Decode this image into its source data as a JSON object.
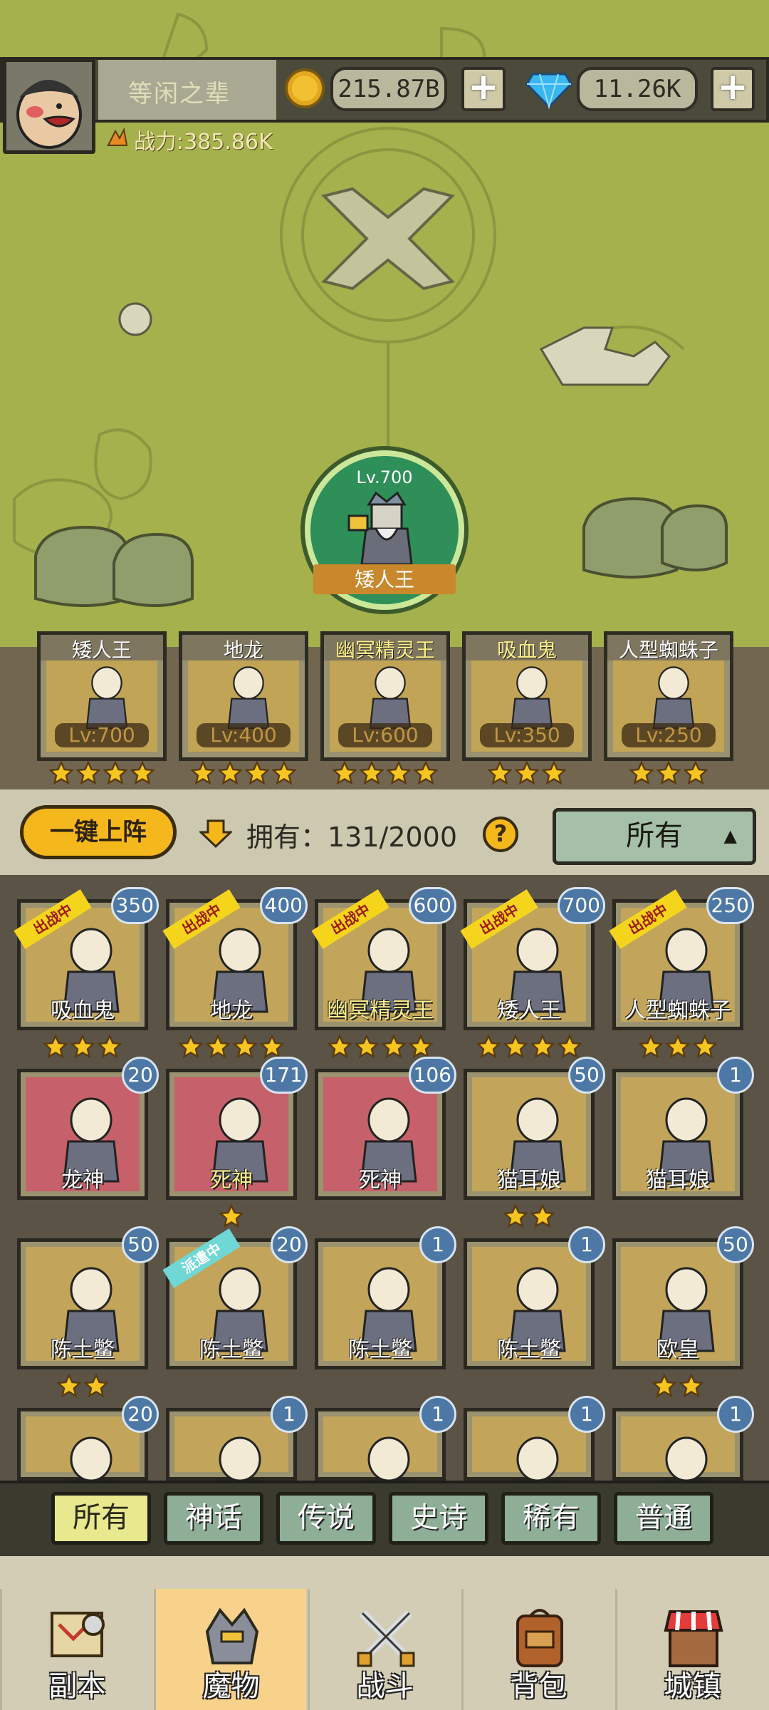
{
  "player": {
    "name": "等闲之辈",
    "power": "战力:385.86K",
    "gold": "215.87B",
    "gems": "11.26K"
  },
  "featured_hero": {
    "level": "Lv.700",
    "name": "矮人王"
  },
  "lineup": [
    {
      "name": "矮人王",
      "level": "Lv:700",
      "stars": 4,
      "highlight": false
    },
    {
      "name": "地龙",
      "level": "Lv:400",
      "stars": 4,
      "highlight": false
    },
    {
      "name": "幽冥精灵王",
      "level": "Lv:600",
      "stars": 4,
      "highlight": true
    },
    {
      "name": "吸血鬼",
      "level": "Lv:350",
      "stars": 3,
      "highlight": true
    },
    {
      "name": "人型蜘蛛子",
      "level": "Lv:250",
      "stars": 3,
      "highlight": false
    }
  ],
  "actions": {
    "deploy_label": "一键上阵",
    "owned_text": "拥有：131/2000",
    "help": "?",
    "filter_value": "所有",
    "filter_caret": "▲"
  },
  "monsters": [
    {
      "name": "吸血鬼",
      "count": "350",
      "tag": "出战中",
      "stars": 3,
      "bg": "gold",
      "gold_name": false
    },
    {
      "name": "地龙",
      "count": "400",
      "tag": "出战中",
      "stars": 4,
      "bg": "gold",
      "gold_name": false
    },
    {
      "name": "幽冥精灵王",
      "count": "600",
      "tag": "出战中",
      "stars": 4,
      "bg": "gold",
      "gold_name": true
    },
    {
      "name": "矮人王",
      "count": "700",
      "tag": "出战中",
      "stars": 4,
      "bg": "gold",
      "gold_name": false
    },
    {
      "name": "人型蜘蛛子",
      "count": "250",
      "tag": "出战中",
      "stars": 3,
      "bg": "gold",
      "gold_name": false
    },
    {
      "name": "龙神",
      "count": "20",
      "tag": "",
      "stars": 0,
      "bg": "red",
      "gold_name": false
    },
    {
      "name": "死神",
      "count": "171",
      "tag": "",
      "stars": 1,
      "bg": "red",
      "gold_name": true
    },
    {
      "name": "死神",
      "count": "106",
      "tag": "",
      "stars": 0,
      "bg": "red",
      "gold_name": false
    },
    {
      "name": "猫耳娘",
      "count": "50",
      "tag": "",
      "stars": 2,
      "bg": "gold",
      "gold_name": false
    },
    {
      "name": "猫耳娘",
      "count": "1",
      "tag": "",
      "stars": 0,
      "bg": "gold",
      "gold_name": false
    },
    {
      "name": "陈土鳖",
      "count": "50",
      "tag": "",
      "stars": 2,
      "bg": "gold",
      "gold_name": false
    },
    {
      "name": "陈土鳖",
      "count": "20",
      "tag": "派遣中",
      "stars": 0,
      "bg": "gold",
      "gold_name": false
    },
    {
      "name": "陈土鳖",
      "count": "1",
      "tag": "",
      "stars": 0,
      "bg": "gold",
      "gold_name": false
    },
    {
      "name": "陈土鳖",
      "count": "1",
      "tag": "",
      "stars": 0,
      "bg": "gold",
      "gold_name": false
    },
    {
      "name": "欧皇",
      "count": "50",
      "tag": "",
      "stars": 2,
      "bg": "gold",
      "gold_name": false
    },
    {
      "name": "",
      "count": "20",
      "tag": "",
      "stars": 0,
      "bg": "gold",
      "gold_name": false
    },
    {
      "name": "",
      "count": "1",
      "tag": "",
      "stars": 0,
      "bg": "gold",
      "gold_name": false
    },
    {
      "name": "",
      "count": "1",
      "tag": "",
      "stars": 0,
      "bg": "gold",
      "gold_name": false
    },
    {
      "name": "",
      "count": "1",
      "tag": "",
      "stars": 0,
      "bg": "gold",
      "gold_name": false
    },
    {
      "name": "",
      "count": "1",
      "tag": "",
      "stars": 0,
      "bg": "gold",
      "gold_name": false
    }
  ],
  "rarity_tabs": [
    {
      "label": "所有",
      "active": true
    },
    {
      "label": "神话",
      "active": false
    },
    {
      "label": "传说",
      "active": false
    },
    {
      "label": "史诗",
      "active": false
    },
    {
      "label": "稀有",
      "active": false
    },
    {
      "label": "普通",
      "active": false
    }
  ],
  "nav": [
    {
      "label": "副本",
      "icon": "map-scroll-icon",
      "active": false
    },
    {
      "label": "魔物",
      "icon": "monster-helmet-icon",
      "active": true
    },
    {
      "label": "战斗",
      "icon": "crossed-swords-icon",
      "active": false
    },
    {
      "label": "背包",
      "icon": "backpack-icon",
      "active": false
    },
    {
      "label": "城镇",
      "icon": "town-shop-icon",
      "active": false
    }
  ],
  "colors": {
    "map_green": "#a4b14c",
    "card_gold": "#c2a55a",
    "card_red": "#c6606a",
    "badge_blue": "#4d78a6",
    "accent_yellow": "#f5b81c"
  }
}
